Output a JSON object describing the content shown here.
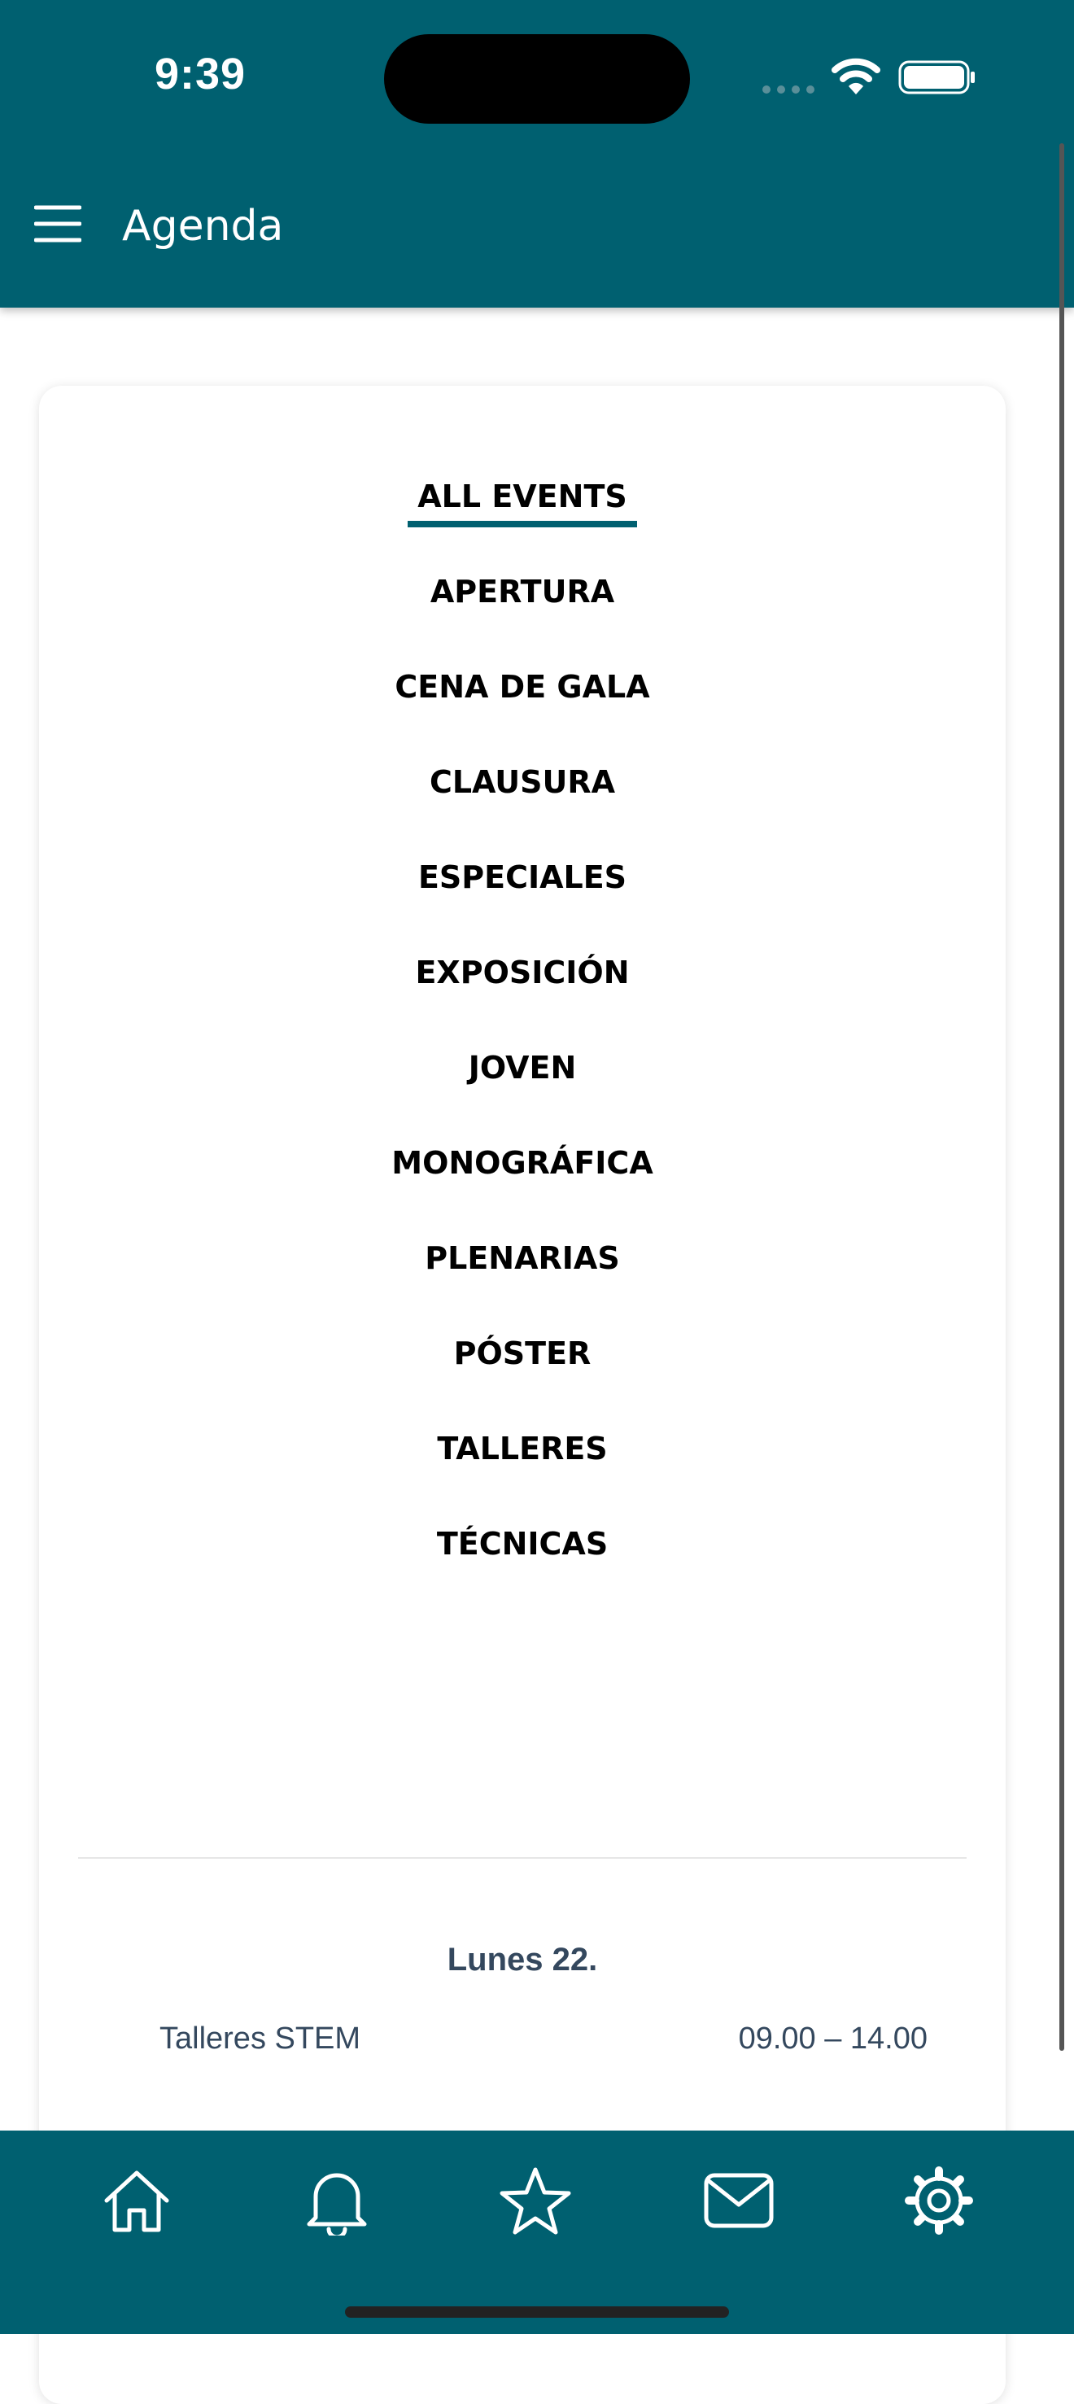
{
  "status_bar": {
    "time": "9:39"
  },
  "header": {
    "title": "Agenda",
    "background_color": "#006070"
  },
  "filters": {
    "active_index": 0,
    "items": [
      {
        "label": "ALL EVENTS"
      },
      {
        "label": "APERTURA"
      },
      {
        "label": "CENA DE GALA"
      },
      {
        "label": "CLAUSURA"
      },
      {
        "label": "ESPECIALES"
      },
      {
        "label": "EXPOSICIÓN"
      },
      {
        "label": "JOVEN"
      },
      {
        "label": "MONOGRÁFICA"
      },
      {
        "label": "PLENARIAS"
      },
      {
        "label": "PÓSTER"
      },
      {
        "label": "TALLERES"
      },
      {
        "label": "TÉCNICAS"
      }
    ]
  },
  "schedule": {
    "day": "Lunes 22.",
    "events": [
      {
        "name": "Talleres STEM",
        "time": "09.00 – 14.00"
      }
    ]
  },
  "tab_bar": {
    "icons": [
      "home-icon",
      "bell-icon",
      "star-icon",
      "mail-icon",
      "gear-icon"
    ]
  }
}
